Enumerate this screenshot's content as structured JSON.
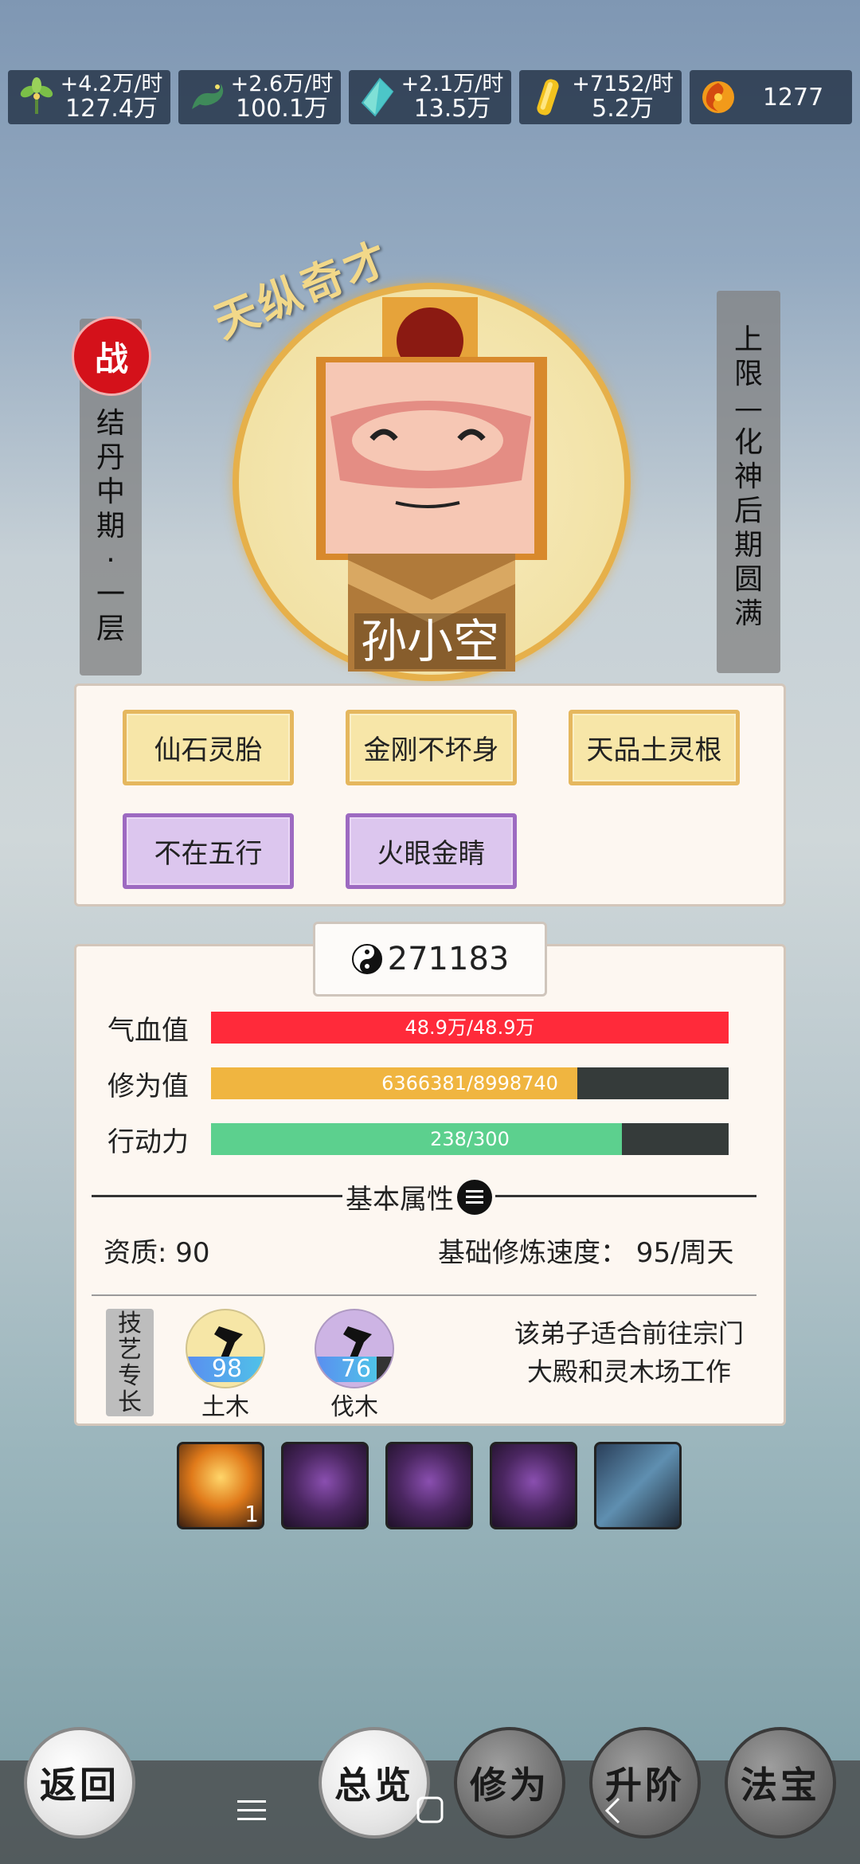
{
  "resources": [
    {
      "icon": "green-herb-icon",
      "rate": "+4.2万/时",
      "amount": "127.4万"
    },
    {
      "icon": "green-dragon-icon",
      "rate": "+2.6万/时",
      "amount": "100.1万"
    },
    {
      "icon": "blue-crystal-icon",
      "rate": "+2.1万/时",
      "amount": "13.5万"
    },
    {
      "icon": "gold-ingot-icon",
      "rate": "+7152/时",
      "amount": "5.2万"
    },
    {
      "icon": "fire-swirl-icon",
      "amount": "1277"
    }
  ],
  "character": {
    "nickname": "天纵奇才",
    "name": "孙小空",
    "battle_badge": "战",
    "realm": "结丹中期·一层",
    "limit": "上限—化神后期圆满"
  },
  "traits": [
    {
      "label": "仙石灵胎",
      "tier": "gold"
    },
    {
      "label": "金刚不坏身",
      "tier": "gold"
    },
    {
      "label": "天品土灵根",
      "tier": "gold"
    },
    {
      "label": "不在五行",
      "tier": "purple"
    },
    {
      "label": "火眼金睛",
      "tier": "purple"
    }
  ],
  "power": "271183",
  "stats": [
    {
      "label": "气血值",
      "value": "48.9万/48.9万",
      "ratio": 1.0,
      "color": "#ff2a3a"
    },
    {
      "label": "修为值",
      "value": "6366381/8998740",
      "ratio": 0.7075,
      "color": "#f0b540"
    },
    {
      "label": "行动力",
      "value": "238/300",
      "ratio": 0.7933,
      "color": "#5cd08e"
    }
  ],
  "section_title": "基本属性",
  "attributes": {
    "aptitude": "资质: 90",
    "speed": "基础修炼速度：  95/周天"
  },
  "skills_tag": "技艺专长",
  "skills": [
    {
      "name": "土木",
      "level": "98",
      "icon": "pickaxe-icon",
      "level_ratio": 0.98,
      "circle": "#f6e6a6"
    },
    {
      "name": "伐木",
      "level": "76",
      "icon": "axe-icon",
      "level_ratio": 0.76,
      "circle": "#cdb4e4"
    }
  ],
  "advice": "该弟子适合前往宗门大殿和灵木场工作",
  "items": [
    {
      "icon": "golden-burst-icon",
      "count": "1"
    },
    {
      "icon": "purple-beast-icon",
      "count": ""
    },
    {
      "icon": "purple-beast-icon",
      "count": ""
    },
    {
      "icon": "purple-beast-icon",
      "count": ""
    },
    {
      "icon": "blue-scroll-icon",
      "count": ""
    }
  ],
  "nav": {
    "back": "返回",
    "overview": "总览",
    "cultivation": "修为",
    "advance": "升阶",
    "treasure": "法宝"
  }
}
